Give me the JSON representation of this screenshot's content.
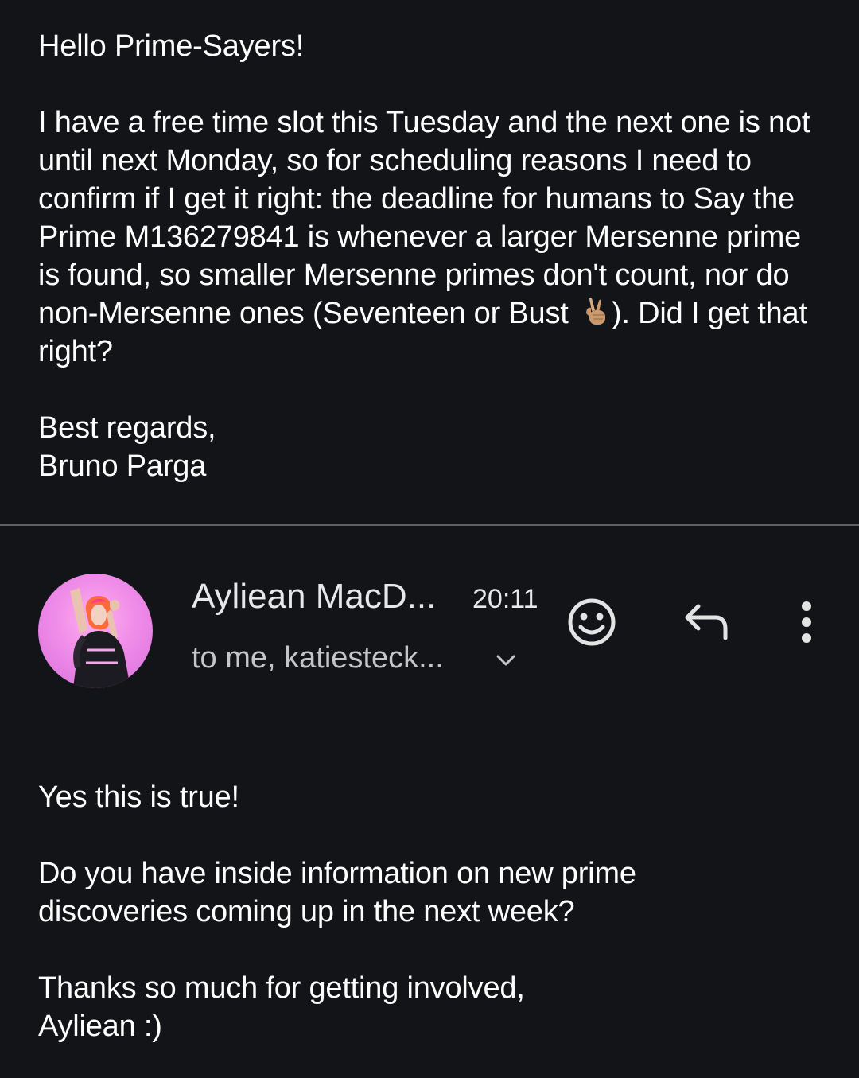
{
  "previous_message": {
    "greeting": "Hello Prime-Sayers!",
    "body_before_emoji": "I have a free time slot this Tuesday and the next one is not until next Monday, so for scheduling reasons I need to confirm if I get it right: the deadline for humans to Say the Prime M136279841 is whenever a larger Mersenne prime is found, so smaller Mersenne primes don't count, nor do non-Mersenne ones (Seventeen or Bust ",
    "emoji": "crossed-fingers-emoji",
    "body_after_emoji": "). Did I get that right?",
    "signoff": "Best regards,",
    "signature": "Bruno Parga"
  },
  "reply_header": {
    "sender_name": "Ayliean MacD...",
    "time": "20:11",
    "recipients": "to me, katiesteck...",
    "avatar": "profile-photo",
    "icons": {
      "emoji": "smiley-icon",
      "reply": "reply-arrow-icon",
      "more": "more-vertical-icon",
      "expand": "chevron-down-icon"
    }
  },
  "reply_message": {
    "line1": "Yes this is true!",
    "line2": "Do you have inside information on new prime discoveries coming up in the next week?",
    "signoff": "Thanks so much for getting involved,",
    "signature": "Ayliean :)"
  },
  "colors": {
    "background": "#131418",
    "text": "#ffffff",
    "secondary_text": "#c4c5c8",
    "divider": "#5f6063",
    "icon": "#e3e3e3"
  }
}
